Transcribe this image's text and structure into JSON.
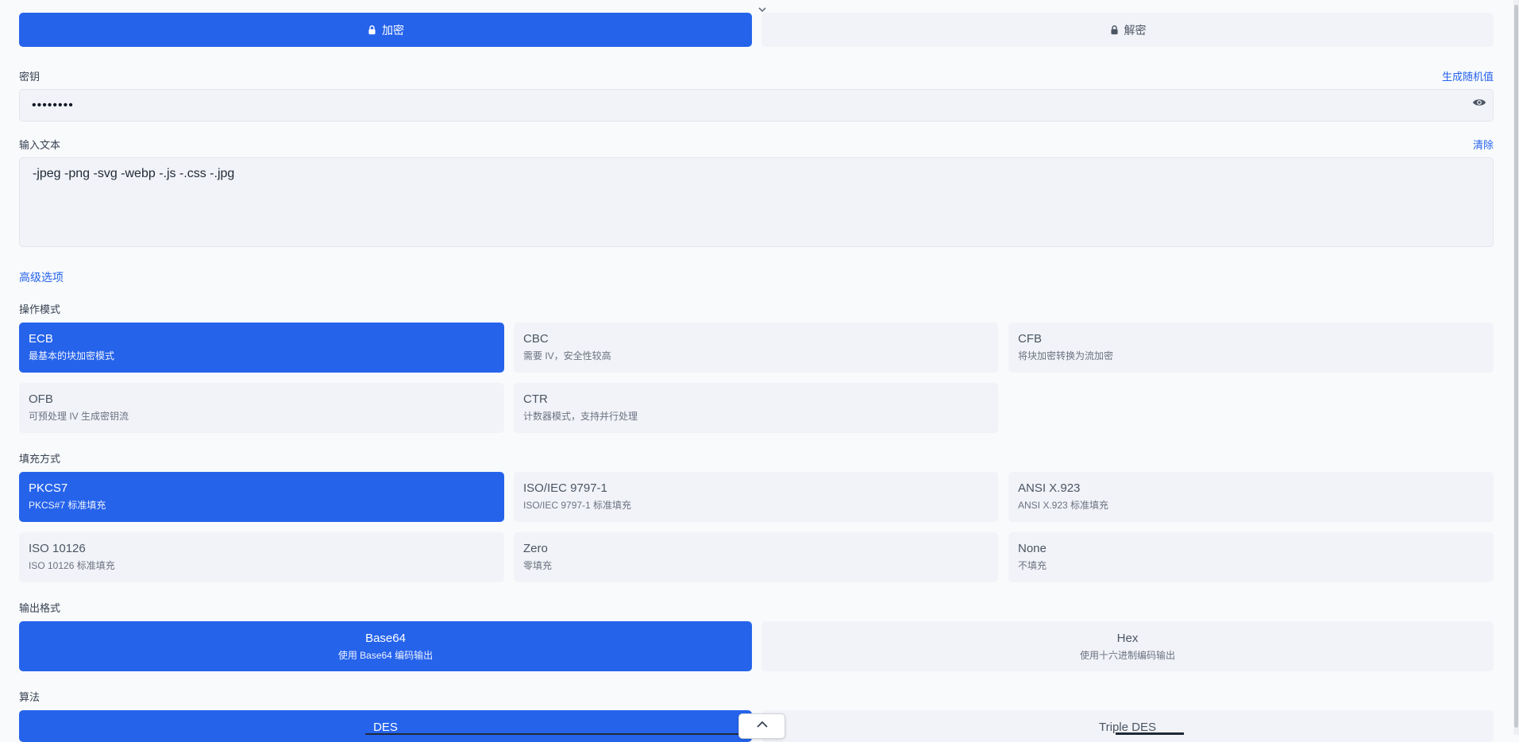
{
  "mode_buttons": [
    {
      "label": "加密",
      "icon": "lock-icon",
      "active": true
    },
    {
      "label": "解密",
      "icon": "lock-icon",
      "active": false
    }
  ],
  "key": {
    "label": "密钥",
    "generate_label": "生成随机值",
    "value": "••••••••",
    "toggle_icon": "eye-icon"
  },
  "input": {
    "label": "输入文本",
    "clear_label": "清除",
    "value": "-jpeg -png -svg -webp -.js -.css -.jpg"
  },
  "advanced_label": "高级选项",
  "operation_mode": {
    "label": "操作模式",
    "options": [
      {
        "title": "ECB",
        "desc": "最基本的块加密模式",
        "active": true
      },
      {
        "title": "CBC",
        "desc": "需要 IV，安全性较高",
        "active": false
      },
      {
        "title": "CFB",
        "desc": "将块加密转换为流加密",
        "active": false
      },
      {
        "title": "OFB",
        "desc": "可预处理 IV 生成密钥流",
        "active": false
      },
      {
        "title": "CTR",
        "desc": "计数器模式，支持并行处理",
        "active": false
      }
    ]
  },
  "padding": {
    "label": "填充方式",
    "options": [
      {
        "title": "PKCS7",
        "desc": "PKCS#7 标准填充",
        "active": true
      },
      {
        "title": "ISO/IEC 9797-1",
        "desc": "ISO/IEC 9797-1 标准填充",
        "active": false
      },
      {
        "title": "ANSI X.923",
        "desc": "ANSI X.923 标准填充",
        "active": false
      },
      {
        "title": "ISO 10126",
        "desc": "ISO 10126 标准填充",
        "active": false
      },
      {
        "title": "Zero",
        "desc": "零填充",
        "active": false
      },
      {
        "title": "None",
        "desc": "不填充",
        "active": false
      }
    ]
  },
  "output_format": {
    "label": "输出格式",
    "options": [
      {
        "title": "Base64",
        "desc": "使用 Base64 编码输出",
        "active": true
      },
      {
        "title": "Hex",
        "desc": "使用十六进制编码输出",
        "active": false
      }
    ]
  },
  "algorithm": {
    "label": "算法",
    "options": [
      {
        "title": "DES",
        "active": true
      },
      {
        "title": "Triple DES",
        "active": false
      }
    ]
  },
  "colors": {
    "accent": "#2563eb",
    "inactive_bg": "#f1f3f8",
    "page_bg": "#f8fafc"
  }
}
